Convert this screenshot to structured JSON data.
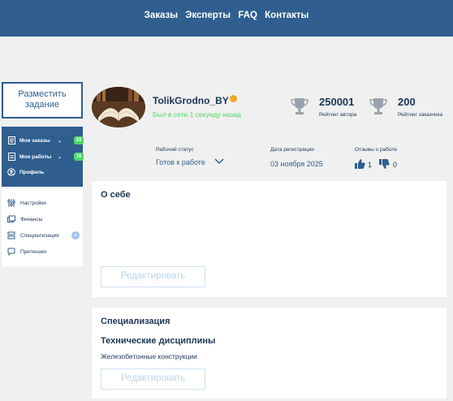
{
  "nav": {
    "items": [
      "Заказы",
      "Эксперты",
      "FAQ",
      "Контакты"
    ]
  },
  "sidebar": {
    "place_order_label": "Разместить задание",
    "primary": [
      {
        "label": "Мои заказы",
        "icon": "orders-icon",
        "badge": "33"
      },
      {
        "label": "Мои работы",
        "icon": "works-icon",
        "badge": "16"
      },
      {
        "label": "Профиль",
        "icon": "profile-icon"
      }
    ],
    "secondary": [
      {
        "label": "Настройки",
        "icon": "settings-icon"
      },
      {
        "label": "Финансы",
        "icon": "finance-icon"
      },
      {
        "label": "Специализация",
        "icon": "specialization-icon"
      },
      {
        "label": "Претензии",
        "icon": "claims-icon"
      }
    ]
  },
  "profile": {
    "username": "TolikGrodno_BY",
    "online_status": "Был в сети 1 секунду назад",
    "author_rating": {
      "value": "250001",
      "label": "Рейтинг автора"
    },
    "customer_rating": {
      "value": "200",
      "label": "Рейтинг заказчика"
    },
    "work_status": {
      "label": "Рабочий статус",
      "value": "Готов к работе"
    },
    "registration": {
      "label": "Дата регистрации",
      "value": "03 ноября 2025"
    },
    "reviews": {
      "label": "Отзывы о работе",
      "likes": "1",
      "dislikes": "0"
    }
  },
  "about": {
    "title": "О себе",
    "edit_label": "Редактировать"
  },
  "specialization": {
    "title": "Специализация",
    "discipline": "Технические дисциплины",
    "subject": "Железобетонные конструкции",
    "edit_label": "Редактировать"
  },
  "colors": {
    "header": "#2f5e8f",
    "accent_green": "#4cd964",
    "badge_orange": "#f5a623"
  }
}
